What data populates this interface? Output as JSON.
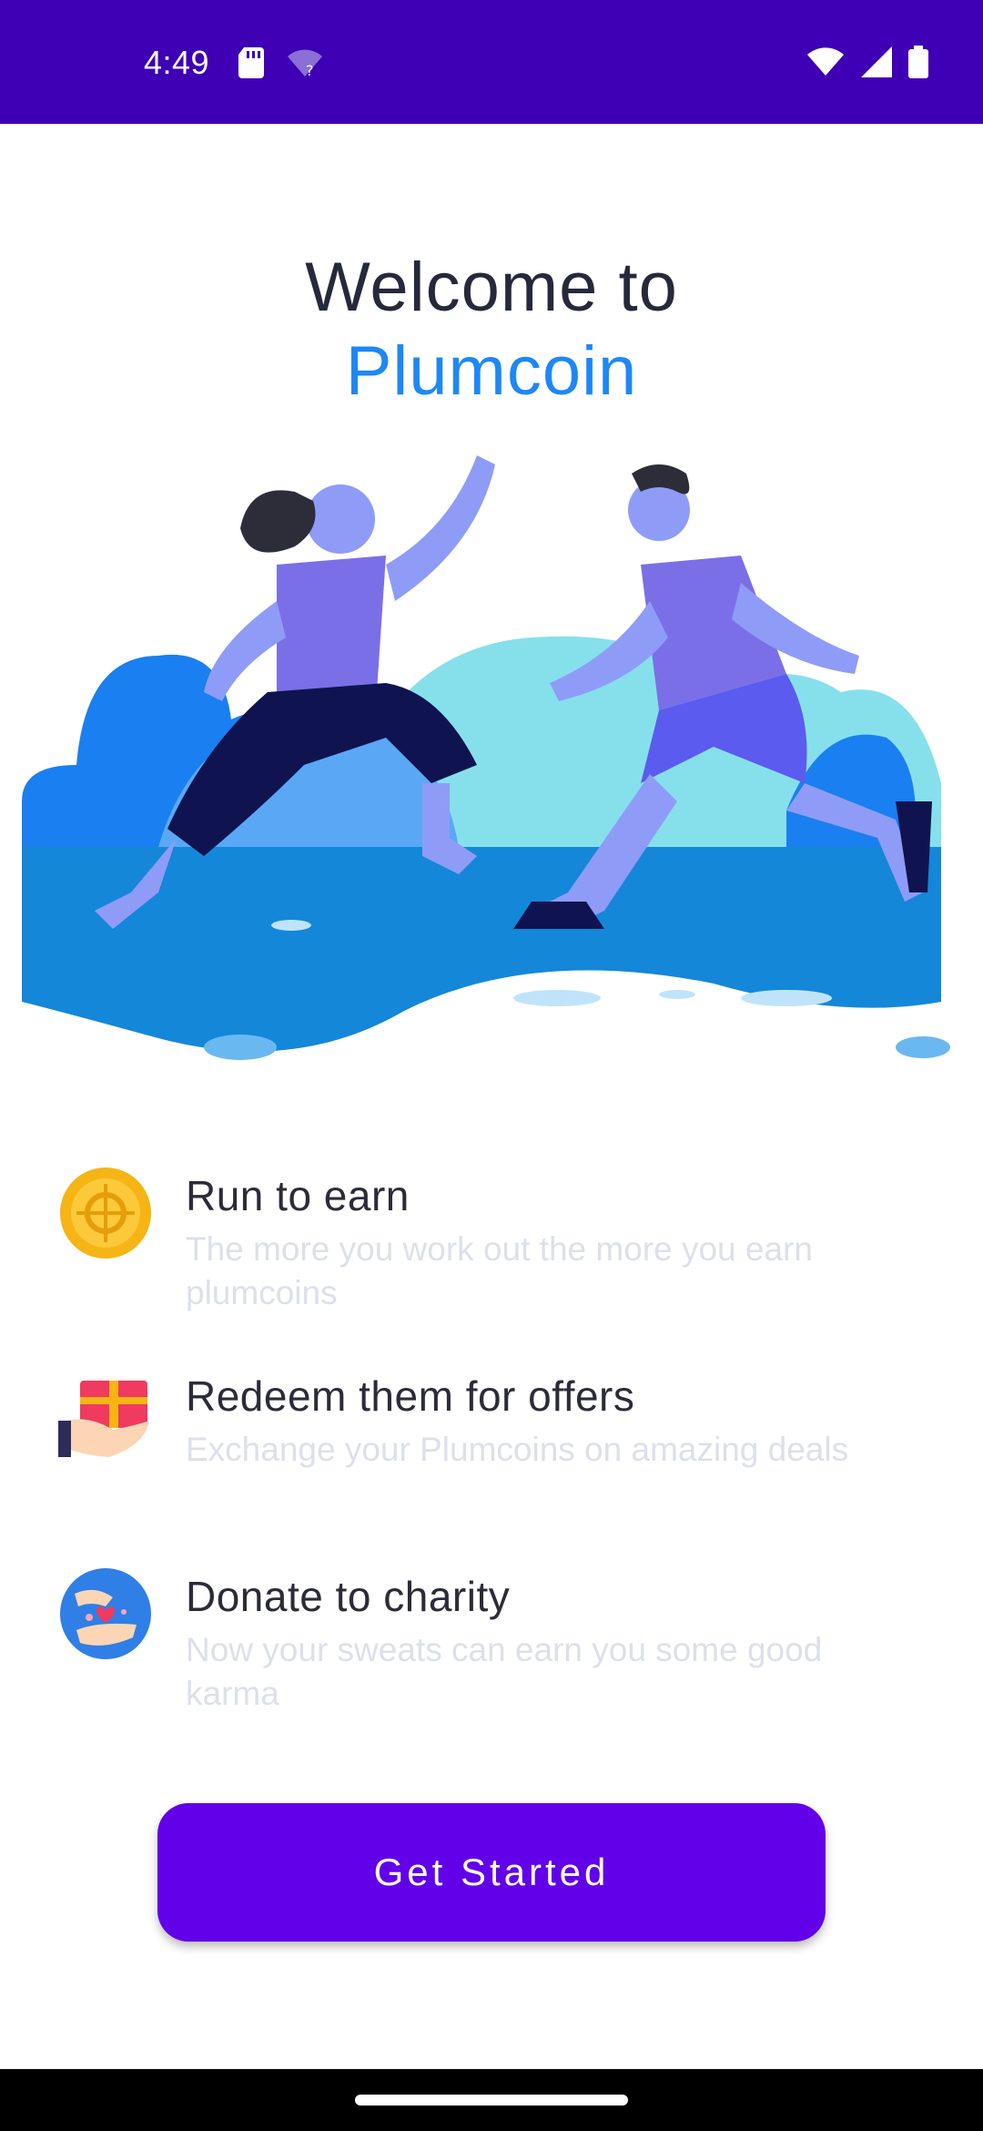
{
  "status_bar": {
    "time": "4:49",
    "icons": [
      "sd-card-icon",
      "wifi-question-icon",
      "wifi-icon",
      "signal-icon",
      "battery-icon"
    ]
  },
  "header": {
    "line1": "Welcome to",
    "line2": "Plumcoin"
  },
  "features": [
    {
      "title": "Run to earn",
      "description": "The more you work out the more you earn plumcoins",
      "icon": "coin-icon"
    },
    {
      "title": "Redeem them for offers",
      "description": "Exchange your Plumcoins on amazing deals",
      "icon": "gift-icon"
    },
    {
      "title": "Donate to charity",
      "description": "Now your sweats can earn you some good karma",
      "icon": "charity-icon"
    }
  ],
  "cta": {
    "label": "Get Started"
  },
  "colors": {
    "status_bar": "#3f00b5",
    "accent_blue": "#1d88f5",
    "button": "#6200ea",
    "text_dark": "#26293b",
    "text_faint": "#dde0ea"
  }
}
